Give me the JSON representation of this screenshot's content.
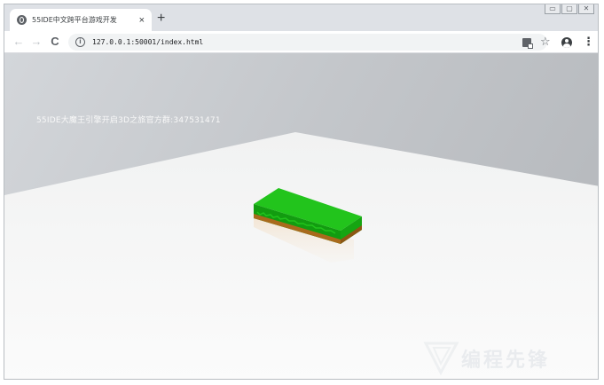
{
  "browser": {
    "tab_title": "55IDE中文跨平台游戏开发",
    "tab_close": "×",
    "new_tab": "+",
    "window_controls": [
      "▭",
      "▢",
      "✕"
    ],
    "url": "127.0.0.1:50001/index.html",
    "nav": {
      "back": "←",
      "forward": "→",
      "reload": "C"
    },
    "menu": "⋮",
    "star": "☆"
  },
  "scene": {
    "overlay_text": "55IDE大魔王引擎开启3D之旅官方群:347531471",
    "colors": {
      "sky": "#c8cbcf",
      "ground": "#f4f4f4",
      "block_top": "#22c41c",
      "block_side": "#129c10",
      "block_dirt": "#b06a1c"
    }
  },
  "watermark": {
    "text": "编程先锋"
  }
}
